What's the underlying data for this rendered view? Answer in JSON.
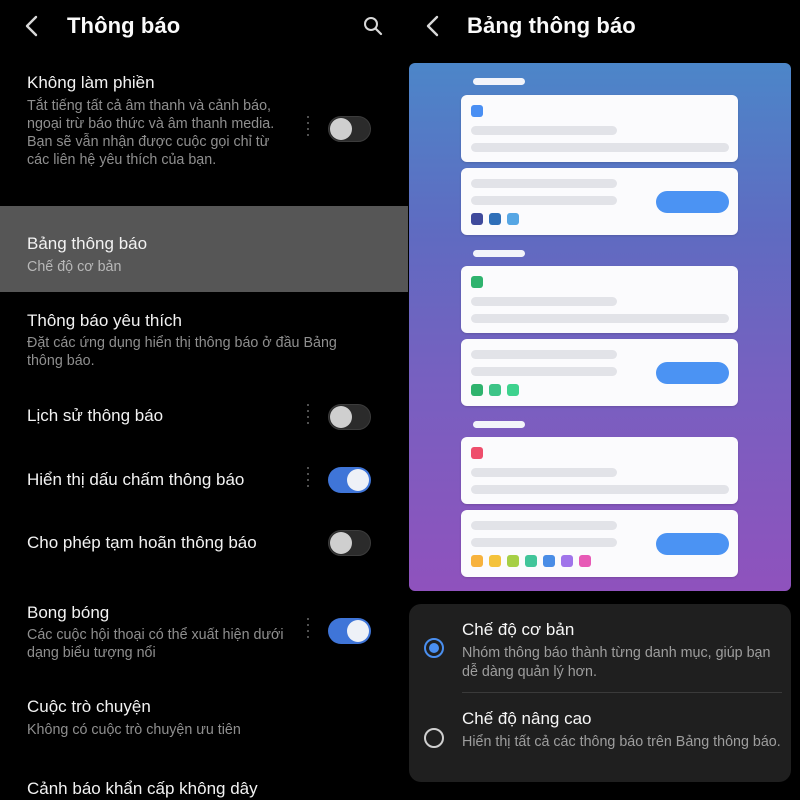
{
  "left": {
    "title": "Thông báo",
    "items": [
      {
        "title": "Không làm phiền",
        "subtitle": "Tắt tiếng tất cả âm thanh và cảnh báo, ngoại trừ báo thức và âm thanh media. Bạn sẽ vẫn nhận được cuộc gọi chỉ từ các liên hệ yêu thích của bạn.",
        "toggle": "off"
      },
      {
        "title": "Bảng thông báo",
        "subtitle": "Chế độ cơ bản"
      },
      {
        "title": "Thông báo yêu thích",
        "subtitle": "Đặt các ứng dụng hiển thị thông báo ở đầu Bảng thông báo."
      },
      {
        "title": "Lịch sử thông báo",
        "toggle": "off"
      },
      {
        "title": "Hiển thị dấu chấm thông báo",
        "toggle": "on"
      },
      {
        "title": "Cho phép tạm hoãn thông báo",
        "toggle": "off"
      },
      {
        "title": "Bong bóng",
        "subtitle": "Các cuộc hội thoại có thể xuất hiện dưới dạng biểu tượng nổi",
        "toggle": "on"
      },
      {
        "title": "Cuộc trò chuyện",
        "subtitle": "Không có cuộc trò chuyện ưu tiên"
      },
      {
        "title": "Cảnh báo khẩn cấp không dây"
      }
    ]
  },
  "right": {
    "title": "Bảng thông báo",
    "preview_group_colors": [
      [
        "#3f4a9c",
        "#2f6fb8",
        "#56a6e4"
      ],
      [
        "#2fb36e",
        "#3dc487",
        "#3ed28e"
      ],
      [
        "#f7b23d",
        "#f4c23b",
        "#a6cf45",
        "#41c59a",
        "#4a8de6",
        "#a074ea",
        "#e75ab6"
      ]
    ],
    "preview_icon_colors": [
      "#4a8ff3",
      "#2fb36e",
      "#ee4e6c"
    ],
    "options": [
      {
        "title": "Chế độ cơ bản",
        "desc": "Nhóm thông báo thành từng danh mục, giúp bạn dễ dàng quản lý hơn.",
        "selected": true
      },
      {
        "title": "Chế độ nâng cao",
        "desc": "Hiển thị tất cả các thông báo trên Bảng thông báo.",
        "selected": false
      }
    ]
  },
  "colors": {
    "accent": "#4a8ff0",
    "toggle_on": "#3f75d8",
    "selected_row": "#565656"
  }
}
